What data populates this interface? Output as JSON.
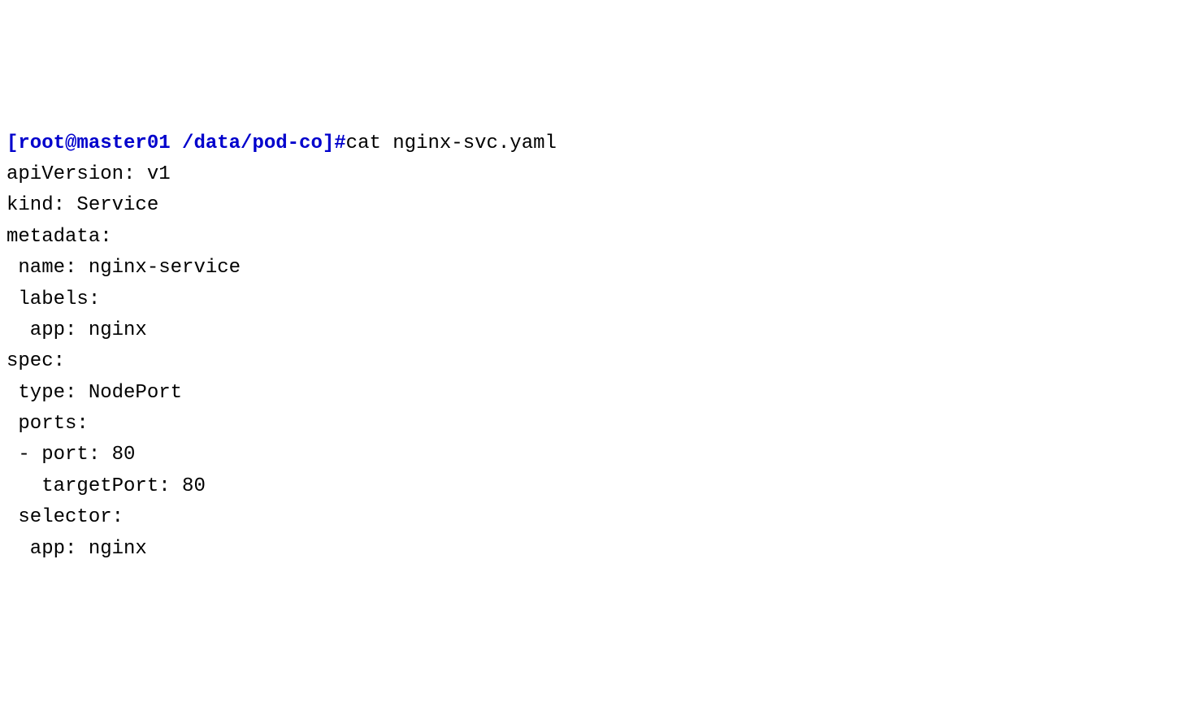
{
  "terminal": {
    "prompt": "[root@master01 /data/pod-co]#",
    "command": "cat nginx-svc.yaml",
    "output_lines": [
      "apiVersion: v1",
      "kind: Service",
      "metadata:",
      " name: nginx-service",
      " labels:",
      "  app: nginx",
      "spec:",
      " type: NodePort",
      " ports:",
      " - port: 80",
      "   targetPort: 80",
      " selector:",
      "  app: nginx"
    ]
  }
}
